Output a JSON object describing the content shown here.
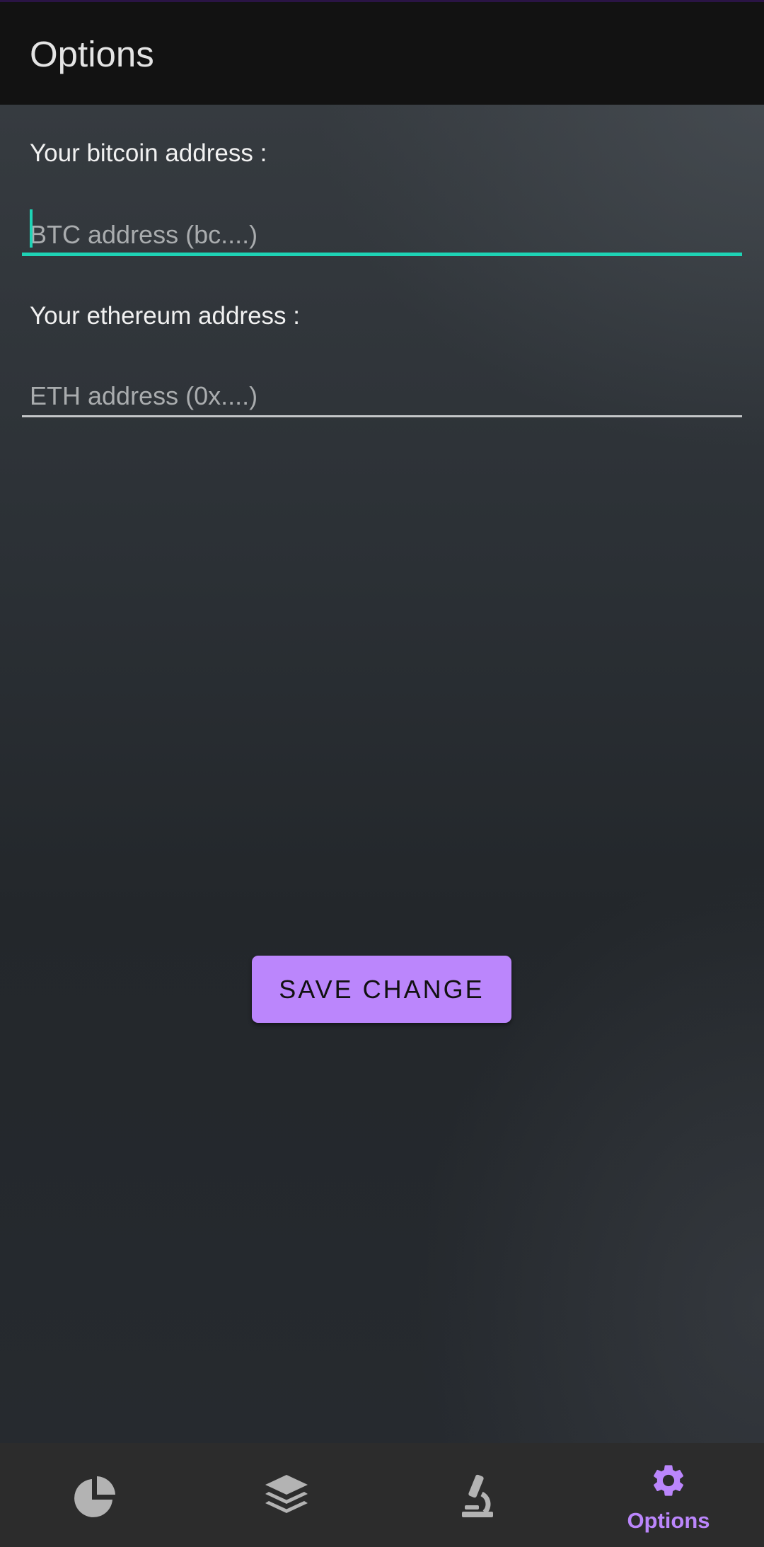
{
  "header": {
    "title": "Options"
  },
  "form": {
    "btc_label": "Your bitcoin address :",
    "btc_placeholder": "BTC address (bc....)",
    "btc_value": "",
    "eth_label": "Your ethereum address :",
    "eth_placeholder": "ETH address (0x....)",
    "eth_value": ""
  },
  "actions": {
    "save_label": "SAVE CHANGE"
  },
  "bottom_nav": {
    "items": [
      {
        "icon": "pie-chart-icon",
        "label": "",
        "active": false
      },
      {
        "icon": "layers-icon",
        "label": "",
        "active": false
      },
      {
        "icon": "microscope-icon",
        "label": "",
        "active": false
      },
      {
        "icon": "gear-icon",
        "label": "Options",
        "active": true
      }
    ]
  },
  "colors": {
    "accent": "#bb86fc",
    "focus": "#1ed3b5",
    "appbar": "#121212",
    "navbar": "#2c2c2c",
    "inactive_icon": "#b3b3b3"
  }
}
